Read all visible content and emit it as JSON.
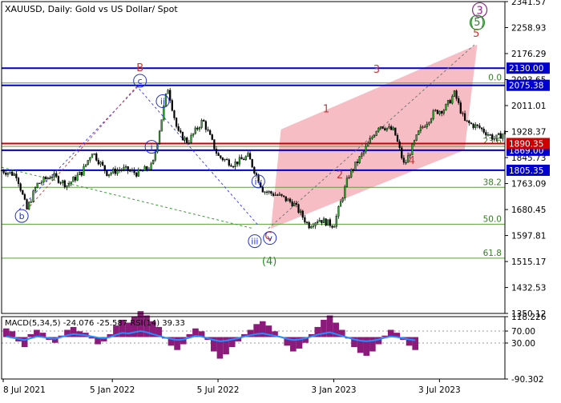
{
  "chart_data": {
    "type": "candlestick",
    "title": "XAUUSD, Daily:  Gold vs US Dollar/ Spot",
    "price_axis": {
      "ylim": [
        1350.12,
        2341.57
      ],
      "ticks": [
        "2341.57",
        "2258.93",
        "2176.29",
        "2093.65",
        "2011.01",
        "1928.37",
        "1845.73",
        "1763.09",
        "1680.45",
        "1597.81",
        "1515.17",
        "1432.53",
        "1350.12"
      ]
    },
    "time_axis": {
      "labels": [
        "8 Jul 2021",
        "5 Jan 2022",
        "5 Jul 2022",
        "3 Jan 2023",
        "3 Jul 2023"
      ]
    },
    "horizontal_levels": [
      {
        "label": "2130.00",
        "value": 2130.0,
        "color": "#0000cc"
      },
      {
        "label": "2075.38",
        "value": 2075.38,
        "color": "#0000cc"
      },
      {
        "label": "1869.00",
        "value": 1869.0,
        "color": "#0000cc"
      },
      {
        "label": "1805.35",
        "value": 1805.35,
        "color": "#0000cc"
      },
      {
        "label": "1890.35",
        "value": 1890.35,
        "color": "#cc0000"
      }
    ],
    "fib_levels": [
      {
        "label": "0.0",
        "value": 2083
      },
      {
        "label": "23.6",
        "value": 1881
      },
      {
        "label": "38.2",
        "value": 1751
      },
      {
        "label": "50.0",
        "value": 1634
      },
      {
        "label": "61.8",
        "value": 1526
      }
    ],
    "wave_labels": {
      "main": [
        "B",
        "C",
        "1",
        "2",
        "3",
        "4",
        "5"
      ],
      "circled": [
        "c",
        "ii",
        "i",
        "iv",
        "iii",
        "v",
        "b"
      ],
      "green": [
        "(4)",
        "(5)"
      ],
      "purple": [
        "3"
      ]
    },
    "channel_color": "#f4a7b0",
    "series": [
      {
        "x": 0,
        "y": 1805
      },
      {
        "x": 0.03,
        "y": 1790
      },
      {
        "x": 0.05,
        "y": 1680
      },
      {
        "x": 0.07,
        "y": 1760
      },
      {
        "x": 0.1,
        "y": 1790
      },
      {
        "x": 0.13,
        "y": 1758
      },
      {
        "x": 0.16,
        "y": 1800
      },
      {
        "x": 0.18,
        "y": 1865
      },
      {
        "x": 0.21,
        "y": 1795
      },
      {
        "x": 0.24,
        "y": 1810
      },
      {
        "x": 0.27,
        "y": 1795
      },
      {
        "x": 0.3,
        "y": 1820
      },
      {
        "x": 0.33,
        "y": 2070
      },
      {
        "x": 0.35,
        "y": 1925
      },
      {
        "x": 0.37,
        "y": 1895
      },
      {
        "x": 0.4,
        "y": 1965
      },
      {
        "x": 0.43,
        "y": 1850
      },
      {
        "x": 0.46,
        "y": 1825
      },
      {
        "x": 0.49,
        "y": 1850
      },
      {
        "x": 0.52,
        "y": 1740
      },
      {
        "x": 0.55,
        "y": 1725
      },
      {
        "x": 0.58,
        "y": 1700
      },
      {
        "x": 0.61,
        "y": 1630
      },
      {
        "x": 0.63,
        "y": 1650
      },
      {
        "x": 0.66,
        "y": 1630
      },
      {
        "x": 0.69,
        "y": 1790
      },
      {
        "x": 0.72,
        "y": 1865
      },
      {
        "x": 0.75,
        "y": 1950
      },
      {
        "x": 0.78,
        "y": 1930
      },
      {
        "x": 0.8,
        "y": 1820
      },
      {
        "x": 0.83,
        "y": 1930
      },
      {
        "x": 0.86,
        "y": 1990
      },
      {
        "x": 0.88,
        "y": 2000
      },
      {
        "x": 0.9,
        "y": 2050
      },
      {
        "x": 0.92,
        "y": 1960
      },
      {
        "x": 0.95,
        "y": 1940
      },
      {
        "x": 0.98,
        "y": 1905
      },
      {
        "x": 1.0,
        "y": 1925
      }
    ],
    "indicator": {
      "title": "MACD(5,34,5) -24.076 -25.587 RSI(14) 39.33",
      "ylim": [
        -90.302,
        118.226
      ],
      "ticks": [
        "118.226",
        "70.00",
        "30.00",
        "-90.302"
      ],
      "rsi_levels": [
        70,
        30
      ],
      "hist": [
        12,
        8,
        -6,
        -14,
        4,
        10,
        6,
        -4,
        -8,
        2,
        10,
        14,
        8,
        6,
        -2,
        -10,
        -6,
        4,
        16,
        24,
        20,
        28,
        36,
        30,
        22,
        14,
        -2,
        -12,
        -18,
        -10,
        4,
        12,
        8,
        -4,
        -20,
        -30,
        -24,
        -14,
        -6,
        4,
        10,
        18,
        22,
        16,
        8,
        0,
        -12,
        -20,
        -16,
        -8,
        4,
        14,
        24,
        30,
        20,
        10,
        -2,
        -14,
        -22,
        -26,
        -20,
        -10,
        2,
        10,
        6,
        -4,
        -12,
        -18
      ],
      "rsi": [
        52,
        48,
        44,
        40,
        46,
        52,
        50,
        46,
        44,
        50,
        56,
        60,
        58,
        56,
        52,
        48,
        46,
        50,
        58,
        64,
        62,
        66,
        70,
        66,
        60,
        54,
        48,
        44,
        40,
        42,
        48,
        54,
        52,
        46,
        40,
        36,
        38,
        42,
        46,
        52,
        56,
        60,
        62,
        58,
        54,
        50,
        44,
        40,
        42,
        46,
        52,
        58,
        62,
        66,
        60,
        54,
        48,
        42,
        38,
        36,
        38,
        42,
        48,
        52,
        50,
        46,
        42,
        39
      ]
    }
  }
}
